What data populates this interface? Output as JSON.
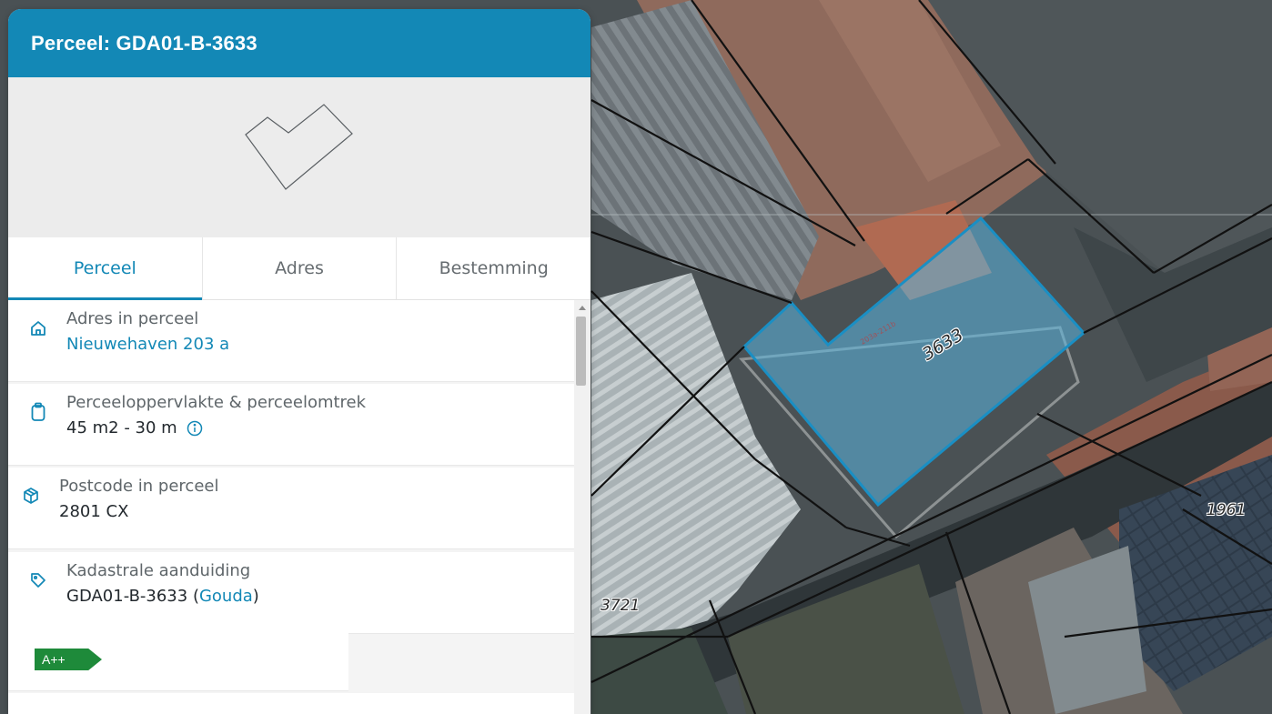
{
  "panel": {
    "title": "Perceel: GDA01-B-3633"
  },
  "tabs": [
    {
      "label": "Perceel",
      "active": true
    },
    {
      "label": "Adres",
      "active": false
    },
    {
      "label": "Bestemming",
      "active": false
    }
  ],
  "cards": {
    "address": {
      "icon": "home-icon",
      "label": "Adres in perceel",
      "value": "Nieuwehaven 203 a"
    },
    "area": {
      "icon": "clipboard-icon",
      "label": "Perceeloppervlakte & perceelomtrek",
      "value": "45 m2 - 30 m"
    },
    "postcode": {
      "icon": "package-icon",
      "label": "Postcode in perceel",
      "value": "2801 CX"
    },
    "cadastral": {
      "icon": "tag-icon",
      "label": "Kadastrale aanduiding",
      "value": "GDA01-B-3633 (",
      "municipality": "Gouda",
      "suffix": ")"
    }
  },
  "energy_label": "A++",
  "map": {
    "parcel_numbers": {
      "selected": "3633",
      "right": "1961",
      "left": "3721"
    },
    "colors": {
      "selected_fill": "#5bb7e0",
      "selected_stroke": "#1a8fc4",
      "boundary": "#111111"
    }
  },
  "colors": {
    "accent": "#1388b6",
    "energy_green": "#1e8a3a"
  }
}
